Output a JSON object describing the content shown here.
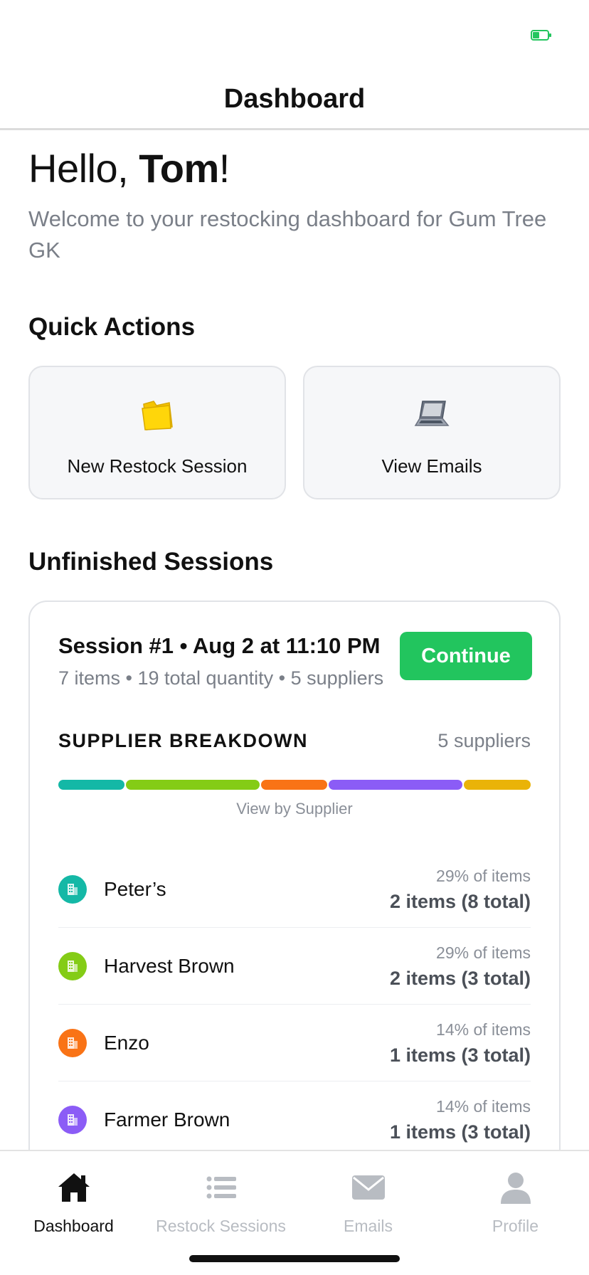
{
  "header": {
    "title": "Dashboard"
  },
  "greeting": {
    "prefix": "Hello, ",
    "name": "Tom",
    "suffix": "!"
  },
  "subtitle": "Welcome to your restocking dashboard for Gum Tree GK",
  "quick_actions": {
    "title": "Quick Actions",
    "items": [
      {
        "label": "New Restock Session",
        "icon": "folder-icon"
      },
      {
        "label": "View Emails",
        "icon": "laptop-icon"
      }
    ]
  },
  "unfinished": {
    "title": "Unfinished Sessions",
    "session": {
      "title": "Session #1 • Aug 2 at 11:10 PM",
      "meta": "7 items • 19 total quantity • 5 suppliers",
      "continue_label": "Continue",
      "breakdown_title": "SUPPLIER BREAKDOWN",
      "breakdown_count": "5 suppliers",
      "view_by": "View by Supplier",
      "suppliers": [
        {
          "name": "Peter’s",
          "percent": "29% of items",
          "quantity": "2 items (8 total)",
          "color": "#14b8a6"
        },
        {
          "name": "Harvest Brown",
          "percent": "29% of items",
          "quantity": "2 items (3 total)",
          "color": "#84cc16"
        },
        {
          "name": "Enzo",
          "percent": "14% of items",
          "quantity": "1 items (3 total)",
          "color": "#f97316"
        },
        {
          "name": "Farmer Brown",
          "percent": "14% of items",
          "quantity": "1 items (3 total)",
          "color": "#8b5cf6"
        }
      ],
      "bar_segments": [
        {
          "fraction": 0.143,
          "color": "#14b8a6"
        },
        {
          "fraction": 0.286,
          "color": "#84cc16"
        },
        {
          "fraction": 0.143,
          "color": "#f97316"
        },
        {
          "fraction": 0.286,
          "color": "#8b5cf6"
        },
        {
          "fraction": 0.143,
          "color": "#eab308"
        }
      ]
    }
  },
  "tabs": [
    {
      "label": "Dashboard",
      "icon": "home-icon",
      "active": true
    },
    {
      "label": "Restock Sessions",
      "icon": "list-icon",
      "active": false
    },
    {
      "label": "Emails",
      "icon": "mail-icon",
      "active": false
    },
    {
      "label": "Profile",
      "icon": "person-icon",
      "active": false
    }
  ],
  "colors": {
    "accent": "#22c55e",
    "muted": "#7a7f88",
    "inactive_tab": "#b8bcc2"
  }
}
